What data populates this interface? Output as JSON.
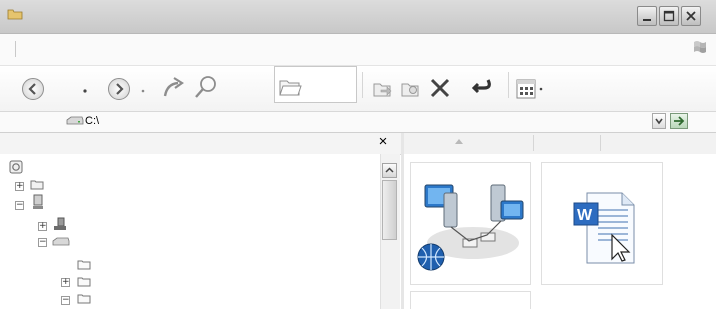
{
  "address": {
    "path": "C:\\"
  },
  "pane": {
    "close_label": "×"
  },
  "window_buttons": {
    "min": "–",
    "max": "□",
    "close": "✕"
  },
  "tree": {
    "items": [
      {
        "icon": "desktop-icon",
        "expander": ""
      },
      {
        "icon": "user-folder-icon",
        "expander": "+"
      },
      {
        "icon": "computer-icon",
        "expander": "−"
      },
      {
        "icon": "floppy-drive-icon",
        "expander": "+"
      },
      {
        "icon": "hard-drive-icon",
        "expander": "−"
      },
      {
        "icon": "folder-icon",
        "expander": ""
      },
      {
        "icon": "folder-icon",
        "expander": "+"
      },
      {
        "icon": "folder-icon",
        "expander": "−"
      }
    ]
  },
  "tiles": [
    {
      "icon": "network-icon"
    },
    {
      "icon": "word-document-icon"
    },
    {
      "icon": "blank-icon"
    }
  ]
}
